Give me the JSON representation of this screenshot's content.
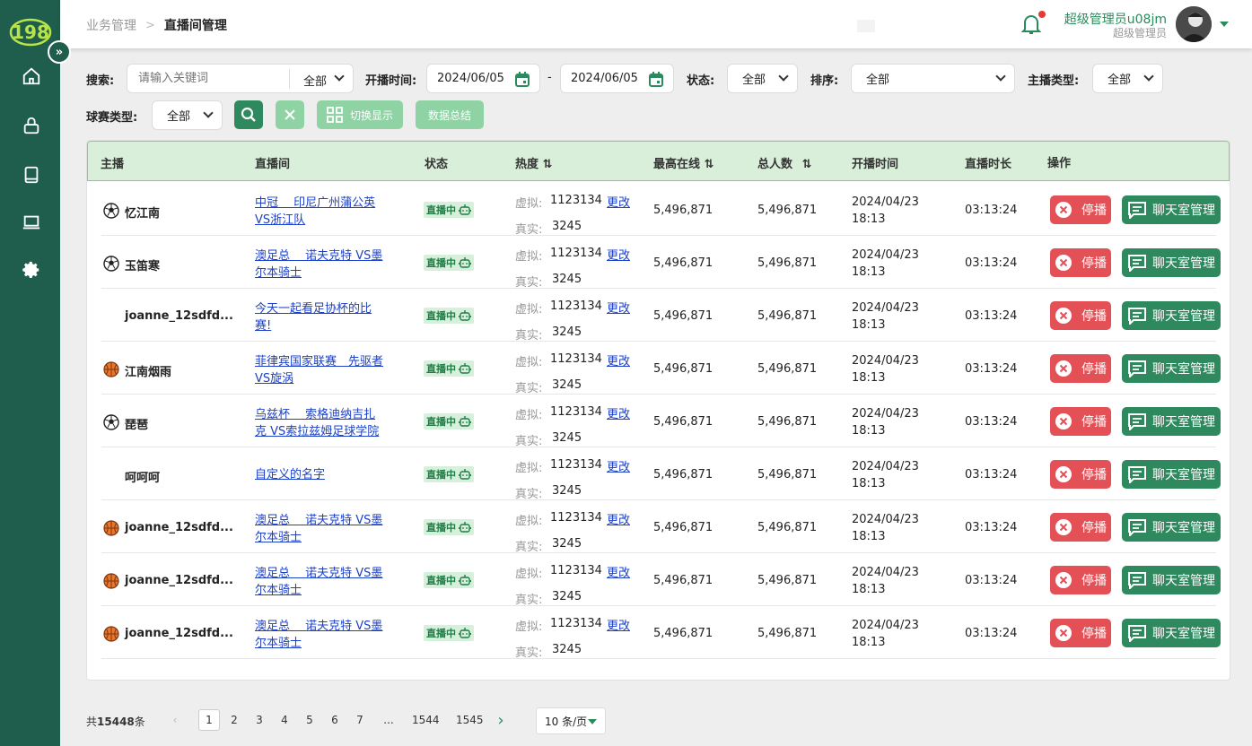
{
  "sidebar": {
    "logo_text": "198",
    "nav_icons": [
      "home-icon",
      "lock-icon",
      "book-icon",
      "monitor-icon",
      "gear-icon"
    ]
  },
  "header": {
    "breadcrumb": [
      "业务管理",
      "直播间管理"
    ],
    "user_name": "超级管理员u08jm",
    "user_role": "超级管理员"
  },
  "filters": {
    "search_label": "搜索:",
    "search_placeholder": "请输入关键词",
    "search_scope": "全部",
    "time_label": "开播时间:",
    "date_from": "2024/06/05",
    "date_sep": "-",
    "date_to": "2024/06/05",
    "status_label": "状态:",
    "status_value": "全部",
    "sort_label": "排序:",
    "sort_value": "全部",
    "anchor_type_label": "主播类型:",
    "anchor_type_value": "全部",
    "game_type_label": "球赛类型:",
    "game_type_value": "全部",
    "toggle_label": "切换显示",
    "summary_label": "数据总结"
  },
  "table": {
    "headers": {
      "anchor": "主播",
      "room": "直播间",
      "status": "状态",
      "heat": "热度",
      "max_online": "最高在线",
      "total": "总人数",
      "start_time": "开播时间",
      "duration": "直播时长",
      "actions": "操作"
    },
    "labels": {
      "virtual": "虚拟:",
      "real": "真实:",
      "edit": "更改",
      "stop": "停播",
      "chat": "聊天室管理"
    },
    "rows": [
      {
        "sport": "soccer",
        "anchor": "忆江南",
        "room1": "中冠　 印尼广州蒲公英",
        "room2": "VS浙江队",
        "status": "直播中",
        "virtual": "1123134",
        "real": "3245",
        "max_online": "5,496,871",
        "total": "5,496,871",
        "date": "2024/04/23",
        "time": "18:13",
        "duration": "03:13:24"
      },
      {
        "sport": "soccer",
        "anchor": "玉笛寒",
        "room1": "澳足总　 诺夫克特 VS墨",
        "room2": "尔本骑士",
        "status": "直播中",
        "virtual": "1123134",
        "real": "3245",
        "max_online": "5,496,871",
        "total": "5,496,871",
        "date": "2024/04/23",
        "time": "18:13",
        "duration": "03:13:24"
      },
      {
        "sport": "none",
        "anchor": "joanne_12sdfd...",
        "room1": "今天一起看足协杯的比",
        "room2": "赛!",
        "status": "直播中",
        "virtual": "1123134",
        "real": "3245",
        "max_online": "5,496,871",
        "total": "5,496,871",
        "date": "2024/04/23",
        "time": "18:13",
        "duration": "03:13:24"
      },
      {
        "sport": "basketball",
        "anchor": "江南烟雨",
        "room1": "菲律宾国家联赛　先驱者",
        "room2": "VS旋涡",
        "status": "直播中",
        "virtual": "1123134",
        "real": "3245",
        "max_online": "5,496,871",
        "total": "5,496,871",
        "date": "2024/04/23",
        "time": "18:13",
        "duration": "03:13:24"
      },
      {
        "sport": "soccer",
        "anchor": "琵琶",
        "room1": "乌兹杯　 索格迪纳吉扎",
        "room2": "克 VS索拉兹姆足球学院",
        "status": "直播中",
        "virtual": "1123134",
        "real": "3245",
        "max_online": "5,496,871",
        "total": "5,496,871",
        "date": "2024/04/23",
        "time": "18:13",
        "duration": "03:13:24"
      },
      {
        "sport": "none",
        "anchor": "呵呵呵",
        "room1": "自定义的名字",
        "room2": "",
        "status": "直播中",
        "virtual": "1123134",
        "real": "3245",
        "max_online": "5,496,871",
        "total": "5,496,871",
        "date": "2024/04/23",
        "time": "18:13",
        "duration": "03:13:24"
      },
      {
        "sport": "basketball",
        "anchor": "joanne_12sdfd...",
        "room1": "澳足总　 诺夫克特 VS墨",
        "room2": "尔本骑士",
        "status": "直播中",
        "virtual": "1123134",
        "real": "3245",
        "max_online": "5,496,871",
        "total": "5,496,871",
        "date": "2024/04/23",
        "time": "18:13",
        "duration": "03:13:24"
      },
      {
        "sport": "basketball",
        "anchor": "joanne_12sdfd...",
        "room1": "澳足总　 诺夫克特 VS墨",
        "room2": "尔本骑士",
        "status": "直播中",
        "virtual": "1123134",
        "real": "3245",
        "max_online": "5,496,871",
        "total": "5,496,871",
        "date": "2024/04/23",
        "time": "18:13",
        "duration": "03:13:24"
      },
      {
        "sport": "basketball",
        "anchor": "joanne_12sdfd...",
        "room1": "澳足总　 诺夫克特 VS墨",
        "room2": "尔本骑士",
        "status": "直播中",
        "virtual": "1123134",
        "real": "3245",
        "max_online": "5,496,871",
        "total": "5,496,871",
        "date": "2024/04/23",
        "time": "18:13",
        "duration": "03:13:24"
      }
    ]
  },
  "pagination": {
    "total_prefix": "共",
    "total": "15448",
    "total_suffix": "条",
    "pages": [
      "1",
      "2",
      "3",
      "4",
      "5",
      "6",
      "7",
      "...",
      "1544",
      "1545"
    ],
    "active_page": "1",
    "page_size": "10 条/页"
  },
  "colors": {
    "sidebar": "#1f5e4c",
    "accent": "#2e8a5e",
    "danger": "#e35157",
    "link": "#1d41c9",
    "header_row": "#d9efda"
  }
}
